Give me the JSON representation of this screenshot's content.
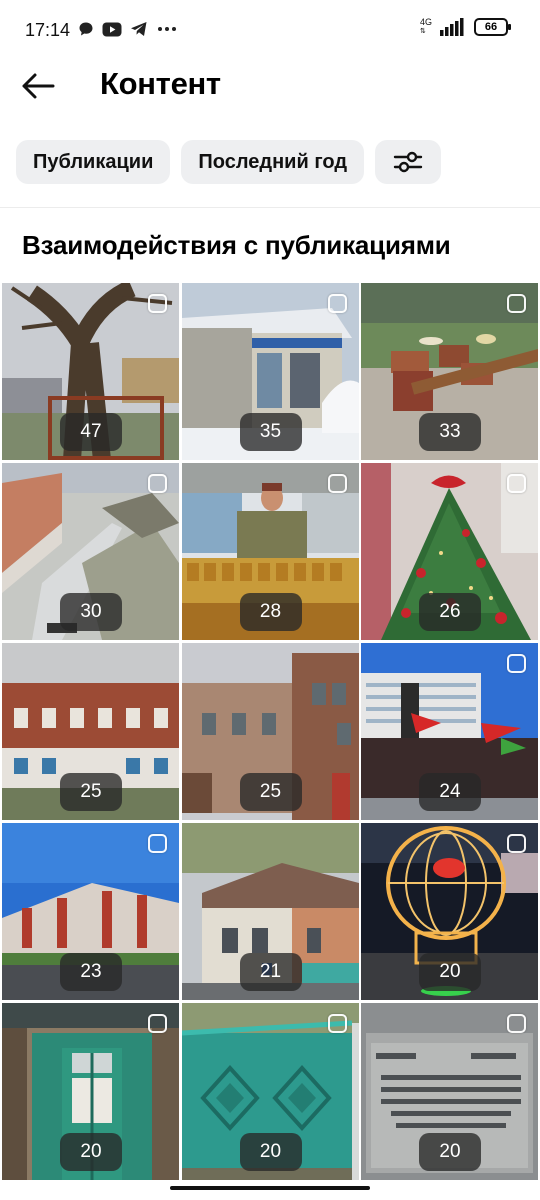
{
  "status_bar": {
    "time": "17:14",
    "network": "4G",
    "battery": "66",
    "left_icons": [
      "chat-bubble-icon",
      "youtube-icon",
      "telegram-icon",
      "more-dots-icon"
    ],
    "right_icons": [
      "signal-icon",
      "battery-icon"
    ]
  },
  "header": {
    "title": "Контент",
    "back_icon": "arrow-left-icon"
  },
  "filters": {
    "items": [
      "Публикации",
      "Последний год"
    ],
    "settings_icon": "sliders-icon"
  },
  "section_title": "Взаимодействия с публикациями",
  "posts": [
    {
      "count": "47",
      "subject": "tree"
    },
    {
      "count": "35",
      "subject": "kiosk"
    },
    {
      "count": "33",
      "subject": "drums"
    },
    {
      "count": "30",
      "subject": "aerial-street"
    },
    {
      "count": "28",
      "subject": "honey-vendor"
    },
    {
      "count": "26",
      "subject": "christmas-tree"
    },
    {
      "count": "25",
      "subject": "brick-building"
    },
    {
      "count": "25",
      "subject": "old-houses"
    },
    {
      "count": "24",
      "subject": "rally"
    },
    {
      "count": "23",
      "subject": "apartment"
    },
    {
      "count": "21",
      "subject": "house-birch"
    },
    {
      "count": "20",
      "subject": "light-sculpture"
    },
    {
      "count": "20",
      "subject": "green-door"
    },
    {
      "count": "20",
      "subject": "green-gate"
    },
    {
      "count": "20",
      "subject": "plaque"
    }
  ]
}
